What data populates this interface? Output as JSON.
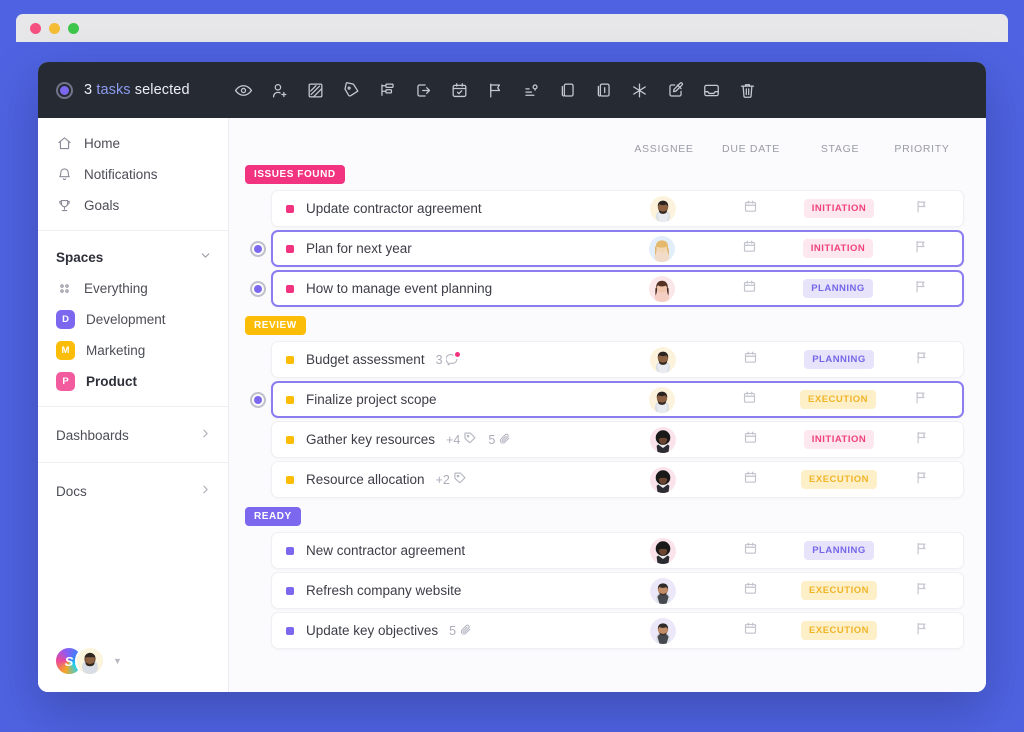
{
  "window": {
    "dots": [
      "close",
      "minimize",
      "maximize"
    ]
  },
  "toolbar": {
    "selected_count": "3",
    "selected_keyword": "tasks",
    "selected_suffix": "selected",
    "icons": [
      {
        "name": "watch-eye-icon",
        "label": "Watch"
      },
      {
        "name": "assign-user-icon",
        "label": "Assign"
      },
      {
        "name": "status-icon",
        "label": "Status"
      },
      {
        "name": "tag-icon",
        "label": "Tags"
      },
      {
        "name": "subtask-icon",
        "label": "Subtasks"
      },
      {
        "name": "move-icon",
        "label": "Move"
      },
      {
        "name": "calendar-check-icon",
        "label": "Due date"
      },
      {
        "name": "flag-icon",
        "label": "Priority"
      },
      {
        "name": "sort-icon",
        "label": "Sort"
      },
      {
        "name": "duplicate-icon",
        "label": "Duplicate"
      },
      {
        "name": "copy-icon",
        "label": "Copy"
      },
      {
        "name": "merge-icon",
        "label": "Merge"
      },
      {
        "name": "edit-icon",
        "label": "Edit"
      },
      {
        "name": "archive-icon",
        "label": "Archive"
      },
      {
        "name": "trash-icon",
        "label": "Delete"
      }
    ]
  },
  "sidebar": {
    "nav": [
      {
        "label": "Home",
        "icon": "home-icon"
      },
      {
        "label": "Notifications",
        "icon": "bell-icon"
      },
      {
        "label": "Goals",
        "icon": "trophy-icon"
      }
    ],
    "spaces_header": "Spaces",
    "spaces": [
      {
        "label": "Everything",
        "icon": "grid-dots-icon",
        "badge": null,
        "color": null,
        "active": false
      },
      {
        "label": "Development",
        "icon": "space-badge",
        "badge": "D",
        "color": "#7b68ee",
        "active": false
      },
      {
        "label": "Marketing",
        "icon": "space-badge",
        "badge": "M",
        "color": "#fbbd08",
        "active": false
      },
      {
        "label": "Product",
        "icon": "space-badge",
        "badge": "P",
        "color": "#f25c9e",
        "active": true
      }
    ],
    "sections": [
      {
        "label": "Dashboards",
        "icon": "chevron-right-icon"
      },
      {
        "label": "Docs",
        "icon": "chevron-right-icon"
      }
    ],
    "footer": {
      "workspace_initial": "S",
      "avatar": "user-avatar",
      "caret": "chevron-down-icon"
    }
  },
  "columns": {
    "assignee": "ASSIGNEE",
    "due_date": "DUE DATE",
    "stage": "STAGE",
    "priority": "PRIORITY"
  },
  "colors": {
    "accent_purple": "#7b68ee",
    "pink": "#f2337f",
    "yellow": "#fbbd08",
    "violet": "#7b68ee",
    "page_background": "#4f63e2",
    "toolbar_background": "#262a33"
  },
  "groups": [
    {
      "name": "ISSUES FOUND",
      "badge_color": "#f2337f",
      "dot_color": "#f2337f",
      "tasks": [
        {
          "title": "Update contractor agreement",
          "selected": false,
          "show_radio": false,
          "meta": [],
          "avatar": "avatar-man-beard-cream",
          "due_date": "calendar-icon",
          "stage": "INITIATION",
          "stage_class": "initiation",
          "priority": "flag-icon"
        },
        {
          "title": "Plan for next year",
          "selected": true,
          "show_radio": true,
          "meta": [],
          "avatar": "avatar-blonde-woman-blue",
          "due_date": "calendar-icon",
          "stage": "INITIATION",
          "stage_class": "initiation",
          "priority": "flag-icon"
        },
        {
          "title": "How to manage event planning",
          "selected": true,
          "show_radio": true,
          "meta": [],
          "avatar": "avatar-woman-pink",
          "due_date": "calendar-icon",
          "stage": "PLANNING",
          "stage_class": "planning",
          "priority": "flag-icon"
        }
      ]
    },
    {
      "name": "REVIEW",
      "badge_color": "#fbbd08",
      "dot_color": "#fbbd08",
      "tasks": [
        {
          "title": "Budget assessment",
          "selected": false,
          "show_radio": false,
          "meta": [
            {
              "type": "comment",
              "value": "3",
              "unread": true
            }
          ],
          "avatar": "avatar-man-beard-cream",
          "due_date": "calendar-icon",
          "stage": "PLANNING",
          "stage_class": "planning",
          "priority": "flag-icon"
        },
        {
          "title": "Finalize project scope",
          "selected": true,
          "show_radio": true,
          "meta": [],
          "avatar": "avatar-man-beard-cream",
          "due_date": "calendar-icon",
          "stage": "EXECUTION",
          "stage_class": "execution",
          "priority": "flag-icon"
        },
        {
          "title": "Gather key resources",
          "selected": false,
          "show_radio": false,
          "meta": [
            {
              "type": "tag",
              "value": "+4",
              "unread": false
            },
            {
              "type": "attachment",
              "value": "5",
              "unread": false
            }
          ],
          "avatar": "avatar-afro-pink",
          "due_date": "calendar-icon",
          "stage": "INITIATION",
          "stage_class": "initiation",
          "priority": "flag-icon"
        },
        {
          "title": "Resource allocation",
          "selected": false,
          "show_radio": false,
          "meta": [
            {
              "type": "tag",
              "value": "+2",
              "unread": false
            }
          ],
          "avatar": "avatar-afro-pink",
          "due_date": "calendar-icon",
          "stage": "EXECUTION",
          "stage_class": "execution",
          "priority": "flag-icon"
        }
      ]
    },
    {
      "name": "READY",
      "badge_color": "#7b68ee",
      "dot_color": "#7b68ee",
      "tasks": [
        {
          "title": "New contractor agreement",
          "selected": false,
          "show_radio": false,
          "meta": [],
          "avatar": "avatar-afro-pink",
          "due_date": "calendar-icon",
          "stage": "PLANNING",
          "stage_class": "planning",
          "priority": "flag-icon"
        },
        {
          "title": "Refresh company website",
          "selected": false,
          "show_radio": false,
          "meta": [],
          "avatar": "avatar-man-lavender",
          "due_date": "calendar-icon",
          "stage": "EXECUTION",
          "stage_class": "execution",
          "priority": "flag-icon"
        },
        {
          "title": "Update key objectives",
          "selected": false,
          "show_radio": false,
          "meta": [
            {
              "type": "attachment",
              "value": "5",
              "unread": false
            }
          ],
          "avatar": "avatar-man-lavender",
          "due_date": "calendar-icon",
          "stage": "EXECUTION",
          "stage_class": "execution",
          "priority": "flag-icon"
        }
      ]
    }
  ]
}
